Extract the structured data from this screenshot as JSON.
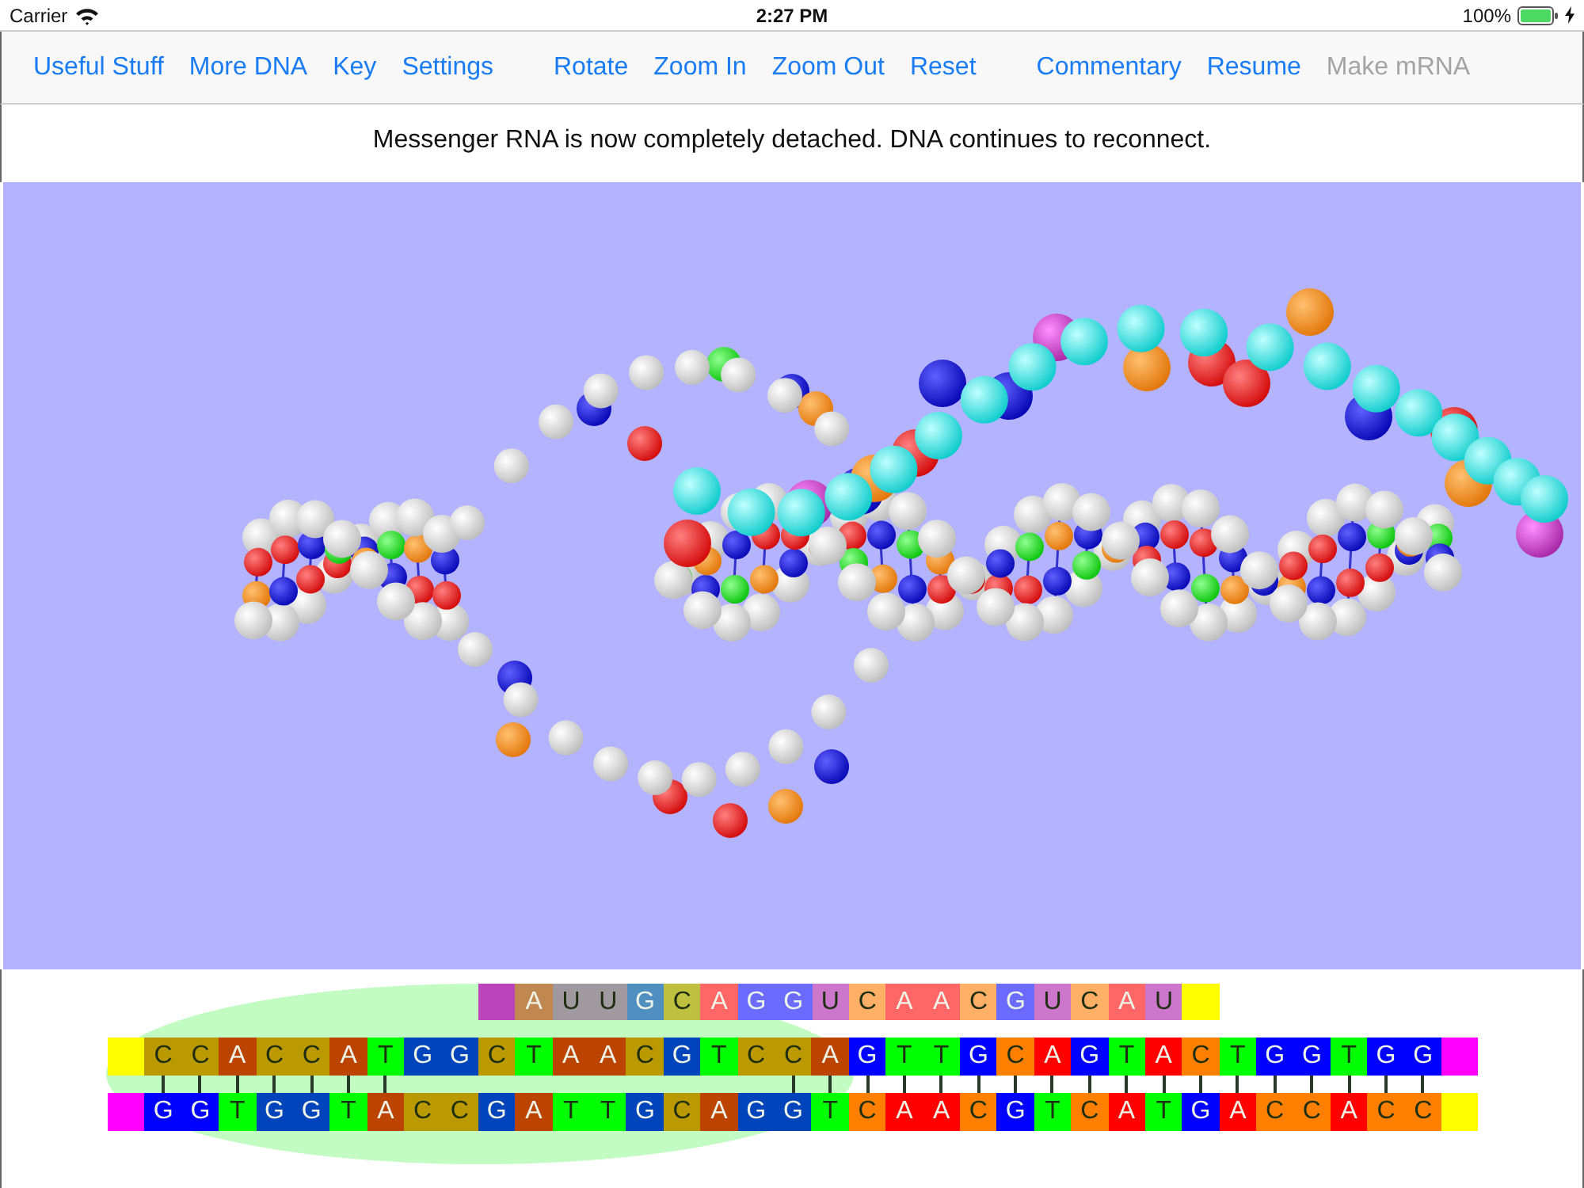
{
  "status_bar": {
    "carrier": "Carrier",
    "time": "2:27 PM",
    "battery": "100%",
    "charging": true
  },
  "toolbar": {
    "groups": [
      {
        "buttons": [
          {
            "label": "Useful Stuff",
            "disabled": false
          },
          {
            "label": "More DNA",
            "disabled": false
          },
          {
            "label": "Key",
            "disabled": false
          },
          {
            "label": "Settings",
            "disabled": false
          }
        ]
      },
      {
        "buttons": [
          {
            "label": "Rotate",
            "disabled": false
          },
          {
            "label": "Zoom In",
            "disabled": false
          },
          {
            "label": "Zoom Out",
            "disabled": false
          },
          {
            "label": "Reset",
            "disabled": false
          }
        ]
      },
      {
        "buttons": [
          {
            "label": "Commentary",
            "disabled": false
          },
          {
            "label": "Resume",
            "disabled": false
          },
          {
            "label": "Make mRNA",
            "disabled": true
          }
        ]
      }
    ]
  },
  "message": "Messenger RNA is now completely detached. DNA continues to reconnect.",
  "sequence_panel": {
    "mrna": {
      "left_end": {
        "color": "#bb44bb"
      },
      "right_end": {
        "color": "#ffff00"
      },
      "bases": [
        {
          "letter": "A",
          "color": "#c08850",
          "light_letter": true
        },
        {
          "letter": "U",
          "color": "#a09aa0",
          "light_letter": false
        },
        {
          "letter": "U",
          "color": "#a09aa0",
          "light_letter": false
        },
        {
          "letter": "G",
          "color": "#5090c0",
          "light_letter": true
        },
        {
          "letter": "C",
          "color": "#c0c040",
          "light_letter": false
        },
        {
          "letter": "A",
          "color": "#ff6666",
          "light_letter": true
        },
        {
          "letter": "G",
          "color": "#6b6bff",
          "light_letter": true
        },
        {
          "letter": "G",
          "color": "#6b6bff",
          "light_letter": true
        },
        {
          "letter": "U",
          "color": "#cc77cc",
          "light_letter": false
        },
        {
          "letter": "C",
          "color": "#ffb066",
          "light_letter": false
        },
        {
          "letter": "A",
          "color": "#ff6666",
          "light_letter": true
        },
        {
          "letter": "A",
          "color": "#ff6666",
          "light_letter": true
        },
        {
          "letter": "C",
          "color": "#ffb066",
          "light_letter": false
        },
        {
          "letter": "G",
          "color": "#6b6bff",
          "light_letter": true
        },
        {
          "letter": "U",
          "color": "#cc77cc",
          "light_letter": false
        },
        {
          "letter": "C",
          "color": "#ffb066",
          "light_letter": false
        },
        {
          "letter": "A",
          "color": "#ff6666",
          "light_letter": true
        },
        {
          "letter": "U",
          "color": "#cc77cc",
          "light_letter": false
        }
      ]
    },
    "dna_top": {
      "left_end": {
        "color": "#ffff00"
      },
      "right_end": {
        "color": "#ff00ff"
      },
      "bases": [
        {
          "letter": "C",
          "color": "#bb9900",
          "light_letter": false
        },
        {
          "letter": "C",
          "color": "#bb9900",
          "light_letter": false
        },
        {
          "letter": "A",
          "color": "#bb4400",
          "light_letter": true
        },
        {
          "letter": "C",
          "color": "#bb9900",
          "light_letter": false
        },
        {
          "letter": "C",
          "color": "#bb9900",
          "light_letter": false
        },
        {
          "letter": "A",
          "color": "#bb4400",
          "light_letter": true
        },
        {
          "letter": "T",
          "color": "#00ff00",
          "light_letter": false
        },
        {
          "letter": "G",
          "color": "#0044bb",
          "light_letter": true
        },
        {
          "letter": "G",
          "color": "#0044bb",
          "light_letter": true
        },
        {
          "letter": "C",
          "color": "#bb9900",
          "light_letter": false
        },
        {
          "letter": "T",
          "color": "#00ff00",
          "light_letter": false
        },
        {
          "letter": "A",
          "color": "#bb4400",
          "light_letter": true
        },
        {
          "letter": "A",
          "color": "#bb4400",
          "light_letter": true
        },
        {
          "letter": "C",
          "color": "#bb9900",
          "light_letter": false
        },
        {
          "letter": "G",
          "color": "#0044bb",
          "light_letter": true
        },
        {
          "letter": "T",
          "color": "#00ff00",
          "light_letter": false
        },
        {
          "letter": "C",
          "color": "#bb9900",
          "light_letter": false
        },
        {
          "letter": "C",
          "color": "#bb9900",
          "light_letter": false
        },
        {
          "letter": "A",
          "color": "#bb4400",
          "light_letter": true
        },
        {
          "letter": "G",
          "color": "#0000ff",
          "light_letter": true
        },
        {
          "letter": "T",
          "color": "#00ff00",
          "light_letter": false
        },
        {
          "letter": "T",
          "color": "#00ff00",
          "light_letter": false
        },
        {
          "letter": "G",
          "color": "#0000ff",
          "light_letter": true
        },
        {
          "letter": "C",
          "color": "#ff8000",
          "light_letter": false
        },
        {
          "letter": "A",
          "color": "#ff0000",
          "light_letter": true
        },
        {
          "letter": "G",
          "color": "#0000ff",
          "light_letter": true
        },
        {
          "letter": "T",
          "color": "#00ff00",
          "light_letter": false
        },
        {
          "letter": "A",
          "color": "#ff0000",
          "light_letter": true
        },
        {
          "letter": "C",
          "color": "#ff8000",
          "light_letter": false
        },
        {
          "letter": "T",
          "color": "#00ff00",
          "light_letter": false
        },
        {
          "letter": "G",
          "color": "#0000ff",
          "light_letter": true
        },
        {
          "letter": "G",
          "color": "#0000ff",
          "light_letter": true
        },
        {
          "letter": "T",
          "color": "#00ff00",
          "light_letter": false
        },
        {
          "letter": "G",
          "color": "#0000ff",
          "light_letter": true
        },
        {
          "letter": "G",
          "color": "#0000ff",
          "light_letter": true
        }
      ]
    },
    "pairs": [
      {
        "paired": true
      },
      {
        "paired": true
      },
      {
        "paired": true
      },
      {
        "paired": true
      },
      {
        "paired": true
      },
      {
        "paired": true
      },
      {
        "paired": true
      },
      {
        "paired": false
      },
      {
        "paired": false
      },
      {
        "paired": false
      },
      {
        "paired": false
      },
      {
        "paired": false
      },
      {
        "paired": false
      },
      {
        "paired": false
      },
      {
        "paired": false
      },
      {
        "paired": false
      },
      {
        "paired": false
      },
      {
        "paired": true
      },
      {
        "paired": true
      },
      {
        "paired": true
      },
      {
        "paired": true
      },
      {
        "paired": true
      },
      {
        "paired": true
      },
      {
        "paired": true
      },
      {
        "paired": true
      },
      {
        "paired": true
      },
      {
        "paired": true
      },
      {
        "paired": true
      },
      {
        "paired": true
      },
      {
        "paired": true
      },
      {
        "paired": true
      },
      {
        "paired": true
      },
      {
        "paired": true
      },
      {
        "paired": true
      },
      {
        "paired": true
      }
    ],
    "dna_bottom": {
      "left_end": {
        "color": "#ff00ff"
      },
      "right_end": {
        "color": "#ffff00"
      },
      "bases": [
        {
          "letter": "G",
          "color": "#0000ff",
          "light_letter": true
        },
        {
          "letter": "G",
          "color": "#0000ff",
          "light_letter": true
        },
        {
          "letter": "T",
          "color": "#00ff00",
          "light_letter": false
        },
        {
          "letter": "G",
          "color": "#0044bb",
          "light_letter": true
        },
        {
          "letter": "G",
          "color": "#0044bb",
          "light_letter": true
        },
        {
          "letter": "T",
          "color": "#00ff00",
          "light_letter": false
        },
        {
          "letter": "A",
          "color": "#bb4400",
          "light_letter": true
        },
        {
          "letter": "C",
          "color": "#bb9900",
          "light_letter": false
        },
        {
          "letter": "C",
          "color": "#bb9900",
          "light_letter": false
        },
        {
          "letter": "G",
          "color": "#0044bb",
          "light_letter": true
        },
        {
          "letter": "A",
          "color": "#bb4400",
          "light_letter": true
        },
        {
          "letter": "T",
          "color": "#00ff00",
          "light_letter": false
        },
        {
          "letter": "T",
          "color": "#00ff00",
          "light_letter": false
        },
        {
          "letter": "G",
          "color": "#0044bb",
          "light_letter": true
        },
        {
          "letter": "C",
          "color": "#bb9900",
          "light_letter": false
        },
        {
          "letter": "A",
          "color": "#bb4400",
          "light_letter": true
        },
        {
          "letter": "G",
          "color": "#0044bb",
          "light_letter": true
        },
        {
          "letter": "G",
          "color": "#0044bb",
          "light_letter": true
        },
        {
          "letter": "T",
          "color": "#00ff00",
          "light_letter": false
        },
        {
          "letter": "C",
          "color": "#ff8000",
          "light_letter": false
        },
        {
          "letter": "A",
          "color": "#ff0000",
          "light_letter": true
        },
        {
          "letter": "A",
          "color": "#ff0000",
          "light_letter": true
        },
        {
          "letter": "C",
          "color": "#ff8000",
          "light_letter": false
        },
        {
          "letter": "G",
          "color": "#0000ff",
          "light_letter": true
        },
        {
          "letter": "T",
          "color": "#00ff00",
          "light_letter": false
        },
        {
          "letter": "C",
          "color": "#ff8000",
          "light_letter": false
        },
        {
          "letter": "A",
          "color": "#ff0000",
          "light_letter": true
        },
        {
          "letter": "T",
          "color": "#00ff00",
          "light_letter": false
        },
        {
          "letter": "G",
          "color": "#0000ff",
          "light_letter": true
        },
        {
          "letter": "A",
          "color": "#ff0000",
          "light_letter": true
        },
        {
          "letter": "C",
          "color": "#ff8000",
          "light_letter": false
        },
        {
          "letter": "C",
          "color": "#ff8000",
          "light_letter": false
        },
        {
          "letter": "A",
          "color": "#ff0000",
          "light_letter": true
        },
        {
          "letter": "C",
          "color": "#ff8000",
          "light_letter": false
        },
        {
          "letter": "C",
          "color": "#ff8000",
          "light_letter": false
        }
      ]
    }
  }
}
